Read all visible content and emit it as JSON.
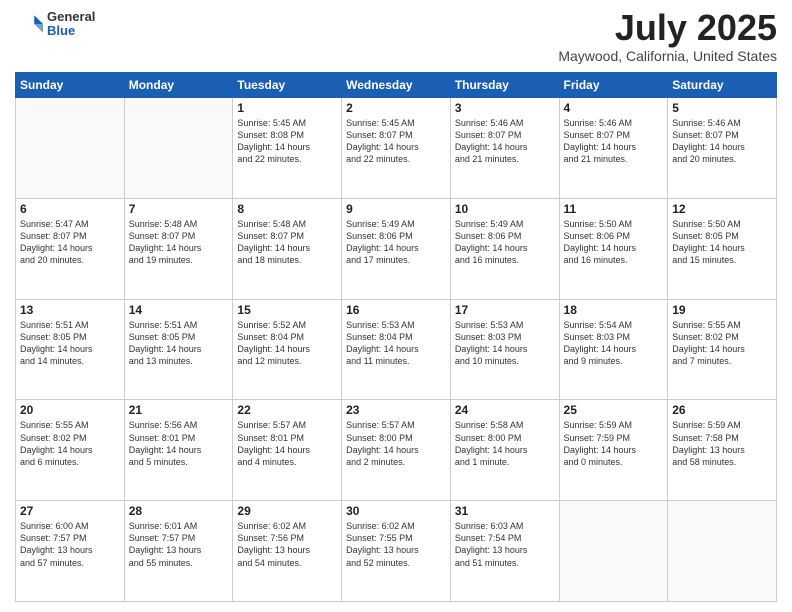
{
  "header": {
    "logo_general": "General",
    "logo_blue": "Blue",
    "month_title": "July 2025",
    "location": "Maywood, California, United States"
  },
  "days_of_week": [
    "Sunday",
    "Monday",
    "Tuesday",
    "Wednesday",
    "Thursday",
    "Friday",
    "Saturday"
  ],
  "weeks": [
    [
      {
        "day": "",
        "info": ""
      },
      {
        "day": "",
        "info": ""
      },
      {
        "day": "1",
        "info": "Sunrise: 5:45 AM\nSunset: 8:08 PM\nDaylight: 14 hours\nand 22 minutes."
      },
      {
        "day": "2",
        "info": "Sunrise: 5:45 AM\nSunset: 8:07 PM\nDaylight: 14 hours\nand 22 minutes."
      },
      {
        "day": "3",
        "info": "Sunrise: 5:46 AM\nSunset: 8:07 PM\nDaylight: 14 hours\nand 21 minutes."
      },
      {
        "day": "4",
        "info": "Sunrise: 5:46 AM\nSunset: 8:07 PM\nDaylight: 14 hours\nand 21 minutes."
      },
      {
        "day": "5",
        "info": "Sunrise: 5:46 AM\nSunset: 8:07 PM\nDaylight: 14 hours\nand 20 minutes."
      }
    ],
    [
      {
        "day": "6",
        "info": "Sunrise: 5:47 AM\nSunset: 8:07 PM\nDaylight: 14 hours\nand 20 minutes."
      },
      {
        "day": "7",
        "info": "Sunrise: 5:48 AM\nSunset: 8:07 PM\nDaylight: 14 hours\nand 19 minutes."
      },
      {
        "day": "8",
        "info": "Sunrise: 5:48 AM\nSunset: 8:07 PM\nDaylight: 14 hours\nand 18 minutes."
      },
      {
        "day": "9",
        "info": "Sunrise: 5:49 AM\nSunset: 8:06 PM\nDaylight: 14 hours\nand 17 minutes."
      },
      {
        "day": "10",
        "info": "Sunrise: 5:49 AM\nSunset: 8:06 PM\nDaylight: 14 hours\nand 16 minutes."
      },
      {
        "day": "11",
        "info": "Sunrise: 5:50 AM\nSunset: 8:06 PM\nDaylight: 14 hours\nand 16 minutes."
      },
      {
        "day": "12",
        "info": "Sunrise: 5:50 AM\nSunset: 8:05 PM\nDaylight: 14 hours\nand 15 minutes."
      }
    ],
    [
      {
        "day": "13",
        "info": "Sunrise: 5:51 AM\nSunset: 8:05 PM\nDaylight: 14 hours\nand 14 minutes."
      },
      {
        "day": "14",
        "info": "Sunrise: 5:51 AM\nSunset: 8:05 PM\nDaylight: 14 hours\nand 13 minutes."
      },
      {
        "day": "15",
        "info": "Sunrise: 5:52 AM\nSunset: 8:04 PM\nDaylight: 14 hours\nand 12 minutes."
      },
      {
        "day": "16",
        "info": "Sunrise: 5:53 AM\nSunset: 8:04 PM\nDaylight: 14 hours\nand 11 minutes."
      },
      {
        "day": "17",
        "info": "Sunrise: 5:53 AM\nSunset: 8:03 PM\nDaylight: 14 hours\nand 10 minutes."
      },
      {
        "day": "18",
        "info": "Sunrise: 5:54 AM\nSunset: 8:03 PM\nDaylight: 14 hours\nand 9 minutes."
      },
      {
        "day": "19",
        "info": "Sunrise: 5:55 AM\nSunset: 8:02 PM\nDaylight: 14 hours\nand 7 minutes."
      }
    ],
    [
      {
        "day": "20",
        "info": "Sunrise: 5:55 AM\nSunset: 8:02 PM\nDaylight: 14 hours\nand 6 minutes."
      },
      {
        "day": "21",
        "info": "Sunrise: 5:56 AM\nSunset: 8:01 PM\nDaylight: 14 hours\nand 5 minutes."
      },
      {
        "day": "22",
        "info": "Sunrise: 5:57 AM\nSunset: 8:01 PM\nDaylight: 14 hours\nand 4 minutes."
      },
      {
        "day": "23",
        "info": "Sunrise: 5:57 AM\nSunset: 8:00 PM\nDaylight: 14 hours\nand 2 minutes."
      },
      {
        "day": "24",
        "info": "Sunrise: 5:58 AM\nSunset: 8:00 PM\nDaylight: 14 hours\nand 1 minute."
      },
      {
        "day": "25",
        "info": "Sunrise: 5:59 AM\nSunset: 7:59 PM\nDaylight: 14 hours\nand 0 minutes."
      },
      {
        "day": "26",
        "info": "Sunrise: 5:59 AM\nSunset: 7:58 PM\nDaylight: 13 hours\nand 58 minutes."
      }
    ],
    [
      {
        "day": "27",
        "info": "Sunrise: 6:00 AM\nSunset: 7:57 PM\nDaylight: 13 hours\nand 57 minutes."
      },
      {
        "day": "28",
        "info": "Sunrise: 6:01 AM\nSunset: 7:57 PM\nDaylight: 13 hours\nand 55 minutes."
      },
      {
        "day": "29",
        "info": "Sunrise: 6:02 AM\nSunset: 7:56 PM\nDaylight: 13 hours\nand 54 minutes."
      },
      {
        "day": "30",
        "info": "Sunrise: 6:02 AM\nSunset: 7:55 PM\nDaylight: 13 hours\nand 52 minutes."
      },
      {
        "day": "31",
        "info": "Sunrise: 6:03 AM\nSunset: 7:54 PM\nDaylight: 13 hours\nand 51 minutes."
      },
      {
        "day": "",
        "info": ""
      },
      {
        "day": "",
        "info": ""
      }
    ]
  ]
}
